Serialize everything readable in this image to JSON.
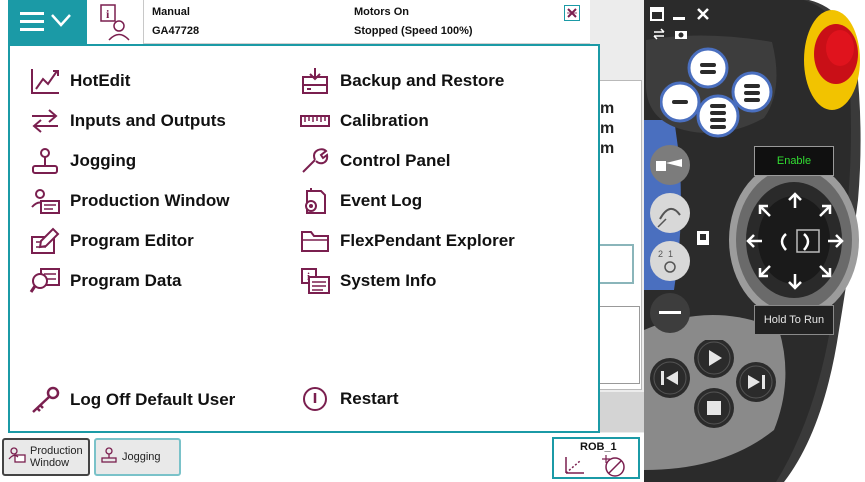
{
  "status": {
    "mode": "Manual",
    "system_name": "GA47728",
    "motors": "Motors On",
    "speed": "Stopped (Speed 100%)"
  },
  "background_app": {
    "right_edge_letters": [
      "m",
      "m",
      "m"
    ]
  },
  "main_menu": {
    "left": [
      {
        "label": "HotEdit",
        "icon": "hotedit-icon"
      },
      {
        "label": "Inputs and Outputs",
        "icon": "inputs-outputs-icon"
      },
      {
        "label": "Jogging",
        "icon": "joystick-icon"
      },
      {
        "label": "Production Window",
        "icon": "production-window-icon"
      },
      {
        "label": "Program Editor",
        "icon": "program-editor-icon"
      },
      {
        "label": "Program Data",
        "icon": "program-data-icon"
      }
    ],
    "right": [
      {
        "label": "Backup and Restore",
        "icon": "backup-icon"
      },
      {
        "label": "Calibration",
        "icon": "calibration-icon"
      },
      {
        "label": "Control Panel",
        "icon": "wrench-icon"
      },
      {
        "label": "Event Log",
        "icon": "event-log-icon"
      },
      {
        "label": "FlexPendant Explorer",
        "icon": "folder-icon"
      },
      {
        "label": "System Info",
        "icon": "system-info-icon"
      }
    ],
    "log_off": "Log Off Default User",
    "restart": "Restart"
  },
  "taskbar": {
    "tasks": [
      {
        "label_line1": "Production",
        "label_line2": "Window"
      },
      {
        "label": "Jogging"
      }
    ],
    "quickset_unit": "ROB_1"
  },
  "device": {
    "enable_label": "Enable",
    "hold_to_run_label": "Hold To Run"
  },
  "colors": {
    "accent": "#1b9aa6",
    "icon": "#7a1f4f",
    "device_blue": "#4a6fbf",
    "device_dark": "#2e2e2e",
    "enable_button": "#e0131d"
  }
}
